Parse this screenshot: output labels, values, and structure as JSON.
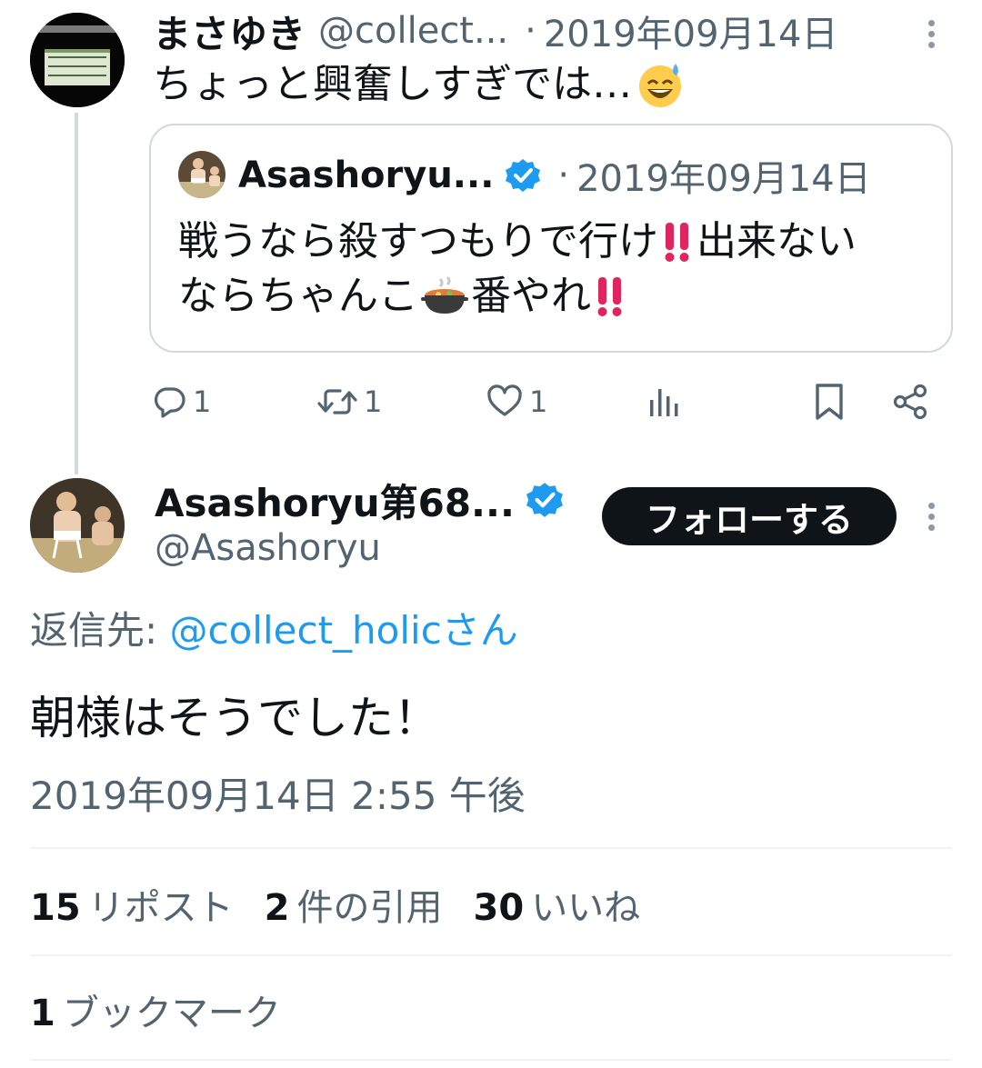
{
  "parent_tweet": {
    "display_name": "まさゆき",
    "handle": "@collect...",
    "separator": "·",
    "date": "2019年09月14日",
    "text": "ちょっと興奮しすぎでは…",
    "emoji": "grinning-sweat-face",
    "quoted": {
      "display_name": "Asashoryu...",
      "separator": "·",
      "date": "2019年09月14日",
      "line1": "戦うなら殺すつもりで行け",
      "line1_tail": "出来ない",
      "line2_a": "ならちゃんこ",
      "line2_b": "番やれ"
    },
    "actions": {
      "reply_count": "1",
      "repost_count": "1",
      "like_count": "1"
    }
  },
  "main_tweet": {
    "display_name": "Asashoryu第68...",
    "handle": "@Asashoryu",
    "follow_label": "フォローする",
    "reply_prefix": "返信先: ",
    "reply_target": "@collect_holicさん",
    "text": "朝様はそうでした！",
    "timestamp": "2019年09月14日 2:55 午後",
    "stats": {
      "reposts_count": "15",
      "reposts_label": "リポスト",
      "quotes_count": "2",
      "quotes_label": "件の引用",
      "likes_count": "30",
      "likes_label": "いいね",
      "bookmarks_count": "1",
      "bookmarks_label": "ブックマーク"
    }
  },
  "colors": {
    "text_primary": "#0f1419",
    "text_secondary": "#536471",
    "link": "#1d9bf0",
    "verified": "#1d9bf0",
    "border": "#cfd9de",
    "follow_button_bg": "#0f1419"
  }
}
